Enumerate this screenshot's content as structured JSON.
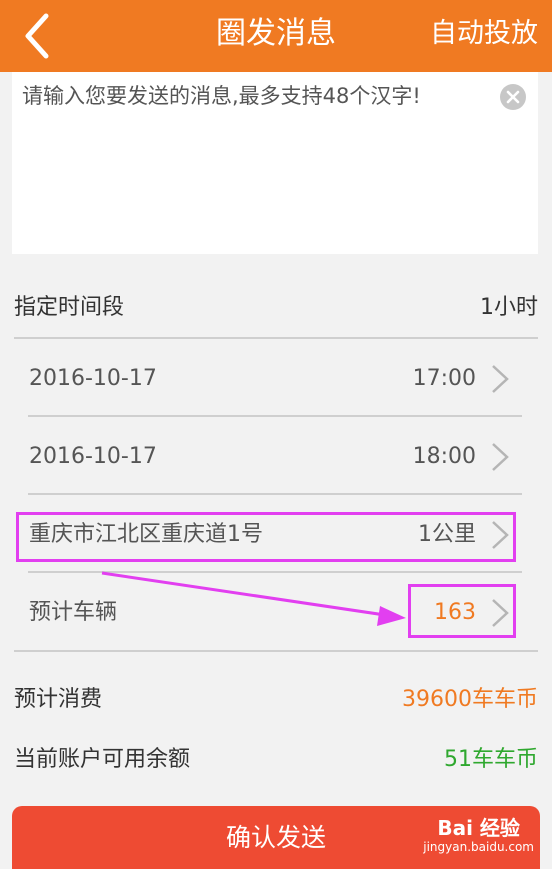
{
  "header": {
    "back_icon": "chevron-left-icon",
    "title": "圈发消息",
    "action": "自动投放"
  },
  "message": {
    "placeholder": "请输入您要发送的消息,最多支持48个汉字!",
    "value": "",
    "clear_icon": "clear-circle-icon"
  },
  "time_period": {
    "label": "指定时间段",
    "value": "1小时"
  },
  "rows": [
    {
      "label": "2016-10-17",
      "value": "17:00"
    },
    {
      "label": "2016-10-17",
      "value": "18:00"
    },
    {
      "label": "重庆市江北区重庆道1号",
      "value": "1公里"
    },
    {
      "label": "预计车辆",
      "value": "163"
    }
  ],
  "summary": {
    "estimated_cost": {
      "label": "预计消费",
      "value": "39600车车币"
    },
    "balance": {
      "label": "当前账户可用余额",
      "value": "51车车币"
    }
  },
  "confirm": {
    "label": "确认发送"
  },
  "watermark": {
    "text": "Bai 经验",
    "sub": "jingyan.baidu.com"
  },
  "colors": {
    "header": "#f07a22",
    "accent_orange": "#f07a22",
    "balance_green": "#2fa82f",
    "confirm_red": "#ee4b33",
    "highlight": "#e23ff0"
  }
}
